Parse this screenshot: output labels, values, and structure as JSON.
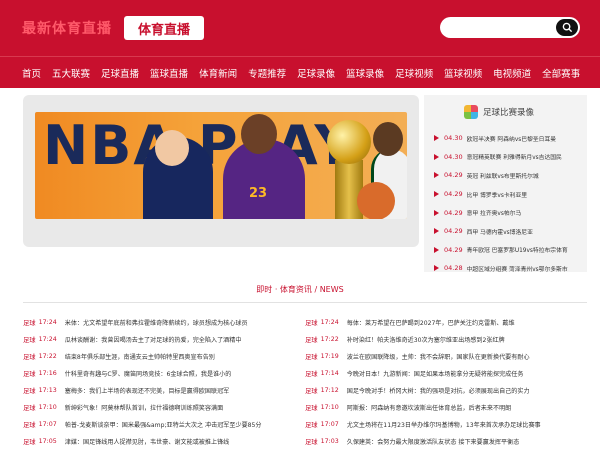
{
  "header": {
    "logo_text": "最新体育直播",
    "title": "体育直播",
    "search": {
      "placeholder": ""
    }
  },
  "nav": {
    "items": [
      "首页",
      "五大联赛",
      "足球直播",
      "篮球直播",
      "体育新闻",
      "专题推荐",
      "足球录像",
      "篮球录像",
      "足球视频",
      "篮球视频",
      "电视频道",
      "全部赛事"
    ]
  },
  "banner": {
    "letters": "NBA PLAY",
    "jersey_number": "23"
  },
  "sidebar": {
    "title": "足球比赛录像",
    "items": [
      {
        "date": "04.30",
        "text": "欧冠半决赛 阿森纳vs巴黎圣日耳曼"
      },
      {
        "date": "04.30",
        "text": "意冠精英联赛 利雅得新月vs吉达国民"
      },
      {
        "date": "04.29",
        "text": "英冠 利兹联vs布里斯托尔城"
      },
      {
        "date": "04.29",
        "text": "比甲 博罗季vs卡利亚里"
      },
      {
        "date": "04.29",
        "text": "意甲 拉齐奥vs帕尔马"
      },
      {
        "date": "04.29",
        "text": "西甲 马德内霍vs博洛尼亚"
      },
      {
        "date": "04.29",
        "text": "青年欧冠 巴塞罗那U19vs特拉布宗体育"
      },
      {
        "date": "04.28",
        "text": "中超区域分组赛 菏泽青州vs鄂尔多斯市"
      }
    ]
  },
  "news": {
    "heading": "即时 · 体育资讯 / NEWS",
    "left": [
      {
        "tag": "足球",
        "time": "17:24",
        "text": "米体：尤文希望年底前和弗拉霍维奇降薪续约，球员想成为核心球员"
      },
      {
        "tag": "足球",
        "time": "17:24",
        "text": "瓜林谈酬谢：我曾因喝汤去主了对足球的热爱，完全陷入了酒精中"
      },
      {
        "tag": "足球",
        "time": "17:22",
        "text": "结束8年俱乐部生涯，南通支云主帅帕特里西奥宣布告别"
      },
      {
        "tag": "足球",
        "time": "17:16",
        "text": "什科里奇有趣与C罗、魔笛同场竞技：6金球合照，我是谁小的"
      },
      {
        "tag": "足球",
        "time": "17:13",
        "text": "塞梅多：我们上半场的表现还不完美，目标是赢得欧国联冠军"
      },
      {
        "tag": "足球",
        "time": "17:10",
        "text": "新绅彩气象！阿莫林帮队首训，拉什福德啊训练照笑容满面"
      },
      {
        "tag": "足球",
        "time": "17:07",
        "text": "帕普-戈麦斯谈奈甲：国米最强&amp;亚特兰大次之 冲击冠军至少要85分"
      },
      {
        "tag": "足球",
        "time": "17:05",
        "text": "津媒：国足锋线用人捉襟见肘，韦世豪、谢文能或被推上锋线"
      }
    ],
    "right": [
      {
        "tag": "足球",
        "time": "17:24",
        "text": "每体：莱万希望在巴萨踢到2027年，巴萨关注约克雷斯、戴维"
      },
      {
        "tag": "足球",
        "time": "17:22",
        "text": "补时染红！帕夫洛维奇近30次为塞尔维亚出场感到2张红牌"
      },
      {
        "tag": "足球",
        "time": "17:19",
        "text": "波兰在欧国联降级，主帅：我不会辞职，国家队在更新换代要有耐心"
      },
      {
        "tag": "足球",
        "time": "17:14",
        "text": "今晚对日本！九游新闻：国足如果本场能拿分无疑将能探完成任务"
      },
      {
        "tag": "足球",
        "time": "17:12",
        "text": "国足今晚对手！桥冈大树：我的强项是对抗，必须展现出自己的实力"
      },
      {
        "tag": "足球",
        "time": "17:10",
        "text": "阿斯报：阿森纳有意邀坎波斯出任体育总监，后者未来不明朗"
      },
      {
        "tag": "足球",
        "time": "17:07",
        "text": "尤文主场将在11月23日举办维尔玛基博物，13年来首次承办足球比赛事"
      },
      {
        "tag": "足球",
        "time": "17:03",
        "text": "久保建英：会努力最大限度激活队友状态 接下来要赢发挥平衡态"
      }
    ]
  }
}
